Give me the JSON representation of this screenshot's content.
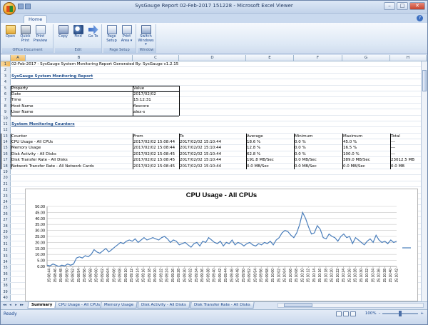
{
  "app": {
    "window_title": "SysGauge Report 02-Feb-2017 151228 - Microsoft Excel Viewer",
    "ribbon_tab": "Home",
    "help_glyph": "?",
    "minimize": "–",
    "maximize": "□",
    "close": "✕"
  },
  "ribbon": {
    "groups": [
      {
        "label": "Office Document",
        "buttons": [
          {
            "label": "Open",
            "icon": "folder-open-icon"
          },
          {
            "label": "Quick Print",
            "icon": "printer-icon"
          },
          {
            "label": "Print Preview",
            "icon": "print-preview-icon"
          }
        ]
      },
      {
        "label": "Edit",
        "buttons": [
          {
            "label": "Copy",
            "icon": "copy-icon"
          },
          {
            "label": "Find",
            "icon": "binoculars-icon"
          },
          {
            "label": "Go To",
            "icon": "arrow-right-icon"
          }
        ]
      },
      {
        "label": "Page Setup",
        "buttons": [
          {
            "label": "Page Setup",
            "icon": "page-setup-icon"
          },
          {
            "label": "Print Area ▾",
            "icon": "print-area-icon"
          }
        ]
      },
      {
        "label": "Window",
        "buttons": [
          {
            "label": "Switch Windows ▾",
            "icon": "switch-windows-icon"
          }
        ]
      }
    ]
  },
  "grid": {
    "columns": [
      "A",
      "B",
      "C",
      "D",
      "E",
      "F",
      "G",
      "H"
    ],
    "row_numbers": [
      "1",
      "2",
      "3",
      "4",
      "5",
      "6",
      "7",
      "8",
      "9",
      "10",
      "11",
      "12",
      "13",
      "14",
      "15",
      "16",
      "17",
      "18",
      "19",
      "20",
      "21",
      "22",
      "23",
      "24",
      "25",
      "26",
      "27",
      "28",
      "29",
      "30",
      "31",
      "32",
      "33",
      "34",
      "35",
      "36",
      "37",
      "38",
      "39",
      "40"
    ],
    "header_line": "02-Feb-2017 - SysGauge System Monitoring Report Generated By: SysGauge v1.2.15",
    "report_title": "SysGauge System Monitoring Report",
    "property_table": {
      "headers": [
        "Property",
        "Value"
      ],
      "rows": [
        [
          "Date",
          "2017/02/02"
        ],
        [
          "Time",
          "15:12:31"
        ],
        [
          "Host Name",
          "flexcore"
        ],
        [
          "User Name",
          "alex-s"
        ]
      ]
    },
    "counters_title": "System Monitoring Counters",
    "counter_table": {
      "headers": [
        "Counter",
        "From",
        "To",
        "Average",
        "Minimum",
        "Maximum",
        "Total"
      ],
      "rows": [
        [
          "CPU Usage - All CPUs",
          "2017/02/02 15:08:44",
          "2017/02/02 15:10:44",
          "18.6 %",
          "0.0 %",
          "45.0 %",
          "---"
        ],
        [
          "Memory Usage",
          "2017/02/02 15:08:44",
          "2017/02/02 15:10:44",
          "12.8 %",
          "0.0 %",
          "16.5 %",
          "---"
        ],
        [
          "Disk Activity - All Disks",
          "2017/02/02 15:08:45",
          "2017/02/02 15:10:44",
          "62.8 %",
          "0.0 %",
          "100.0 %",
          "---"
        ],
        [
          "Disk Transfer Rate - All Disks",
          "2017/02/02 15:08:45",
          "2017/02/02 15:10:44",
          "191.8 MB/Sec",
          "0.0 MB/Sec",
          "389.0 MB/Sec",
          "23012.5 MB"
        ],
        [
          "Network Transfer Rate - All Network Cards",
          "2017/02/02 15:08:45",
          "2017/02/02 15:10:44",
          "0.0 MB/Sec",
          "0.0 MB/Sec",
          "0.0 MB/Sec",
          "0.0 MB"
        ]
      ]
    }
  },
  "chart_data": {
    "type": "line",
    "title": "CPU Usage - All CPUs",
    "xlabel": "",
    "ylabel": "",
    "ylim": [
      0,
      50
    ],
    "yticks": [
      "0.00",
      "5.00",
      "10.00",
      "15.00",
      "20.00",
      "25.00",
      "30.00",
      "35.00",
      "40.00",
      "45.00",
      "50.00"
    ],
    "grid": true,
    "line_color": "#4a7ebb",
    "x": [
      "15:08:44",
      "15:08:46",
      "15:08:48",
      "15:08:50",
      "15:08:52",
      "15:08:54",
      "15:08:56",
      "15:08:58",
      "15:09:00",
      "15:09:02",
      "15:09:04",
      "15:09:06",
      "15:09:08",
      "15:09:10",
      "15:09:12",
      "15:09:14",
      "15:09:16",
      "15:09:18",
      "15:09:20",
      "15:09:22",
      "15:09:24",
      "15:09:26",
      "15:09:28",
      "15:09:30",
      "15:09:32",
      "15:09:34",
      "15:09:36",
      "15:09:38",
      "15:09:40",
      "15:09:42",
      "15:09:44",
      "15:09:46",
      "15:09:48",
      "15:09:50",
      "15:09:52",
      "15:09:54",
      "15:09:56",
      "15:09:58",
      "15:10:00",
      "15:10:02",
      "15:10:04",
      "15:10:06",
      "15:10:08",
      "15:10:10",
      "15:10:12",
      "15:10:14",
      "15:10:16",
      "15:10:18",
      "15:10:20",
      "15:10:22",
      "15:10:24",
      "15:10:26",
      "15:10:28",
      "15:10:30",
      "15:10:32",
      "15:10:34",
      "15:10:36",
      "15:10:38",
      "15:10:40",
      "15:10:42"
    ],
    "values": [
      1,
      0.5,
      2,
      1,
      0,
      1,
      0.5,
      2,
      1,
      2,
      7,
      8,
      7,
      9,
      8,
      10,
      14,
      12,
      11,
      13,
      15,
      12,
      14,
      16,
      18,
      20,
      19,
      21,
      22,
      21,
      23,
      20,
      22,
      24,
      22,
      23,
      24,
      23,
      22,
      24,
      25,
      23,
      20,
      22,
      21,
      18,
      19,
      20,
      18,
      16,
      19,
      20,
      17,
      21,
      20,
      24,
      22,
      20,
      19,
      21,
      17,
      20,
      19,
      22,
      18,
      20,
      19,
      17,
      19,
      20,
      18,
      17,
      19,
      18,
      20,
      19,
      21,
      18,
      22,
      24,
      28,
      30,
      29,
      26,
      24,
      28,
      35,
      45,
      40,
      33,
      27,
      28,
      34,
      31,
      24,
      23,
      27,
      25,
      24,
      21,
      25,
      27,
      24,
      25,
      19,
      24,
      22,
      20,
      18,
      21,
      23,
      20,
      26,
      22,
      20,
      21,
      19,
      22,
      20,
      21
    ]
  },
  "sheet_tabs": [
    "Summary",
    "CPU Usage - All CPUs",
    "Memory Usage",
    "Disk Activity - All Disks",
    "Disk Transfer Rate - All Disks"
  ],
  "status": {
    "ready": "Ready",
    "zoom": "100%",
    "zoom_minus": "–",
    "zoom_plus": "+"
  }
}
